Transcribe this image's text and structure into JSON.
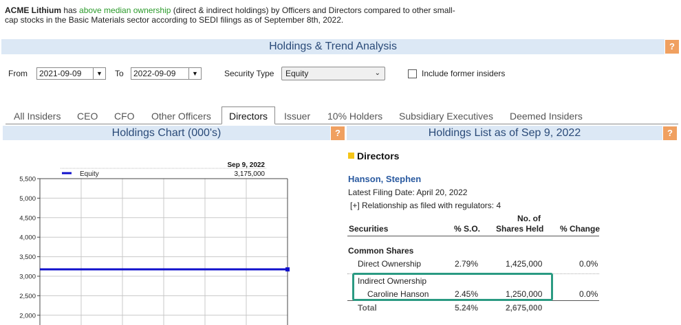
{
  "intro": {
    "company": "ACME Lithium",
    "t1": " has ",
    "highlight": "above median ownership",
    "t2": " (direct & indirect holdings) by Officers and Directors compared to other small-cap stocks in the Basic Materials sector according to SEDI filings as of September 8th, 2022."
  },
  "analysis_title": "Holdings & Trend Analysis",
  "help_glyph": "?",
  "filters": {
    "from_label": "From",
    "from_value": "2021-09-09",
    "to_label": "To",
    "to_value": "2022-09-09",
    "security_type_label": "Security Type",
    "security_type_value": "Equity",
    "include_former_label": "Include former insiders"
  },
  "tabs": [
    "All Insiders",
    "CEO",
    "CFO",
    "Other Officers",
    "Directors",
    "Issuer",
    "10% Holders",
    "Subsidiary Executives",
    "Deemed Insiders"
  ],
  "active_tab": "Directors",
  "chart_panel_title": "Holdings Chart (000's)",
  "list_panel_title": "Holdings List as of Sep 9, 2022",
  "chart_data": {
    "type": "line",
    "title": "",
    "xlabel": "",
    "ylabel": "",
    "ylim": [
      2000,
      5500
    ],
    "yticks": [
      "5,500",
      "5,000",
      "4,500",
      "4,000",
      "3,500",
      "3,000",
      "2,500",
      "2,000"
    ],
    "ytick_values": [
      5500,
      5000,
      4500,
      4000,
      3500,
      3000,
      2500,
      2000
    ],
    "series": [
      {
        "name": "Equity",
        "values": [
          3175,
          3175
        ]
      }
    ],
    "marker_label_date": "Sep 9, 2022",
    "marker_label_value": "3,175,000",
    "grid": true,
    "legend": "top-left",
    "series_color": "#1010cc"
  },
  "holdings": {
    "group_title": "Directors",
    "person_name": "Hanson, Stephen",
    "latest_filing": "Latest Filing Date: April 20, 2022",
    "relationship": "[+]  Relationship as filed with regulators: 4",
    "col_securities": "Securities",
    "col_so": "% S.O.",
    "col_shares_1": "No. of",
    "col_shares_2": "Shares Held",
    "col_change": "% Change",
    "section": "Common Shares",
    "rows": [
      {
        "label": "Direct Ownership",
        "so": "2.79%",
        "shares": "1,425,000",
        "change": "0.0%"
      },
      {
        "label": "Indirect Ownership",
        "so": "",
        "shares": "",
        "change": ""
      },
      {
        "label": "Caroline Hanson",
        "so": "2.45%",
        "shares": "1,250,000",
        "change": "0.0%"
      }
    ],
    "total_label": "Total",
    "total_so": "5.24%",
    "total_shares": "2,675,000"
  }
}
